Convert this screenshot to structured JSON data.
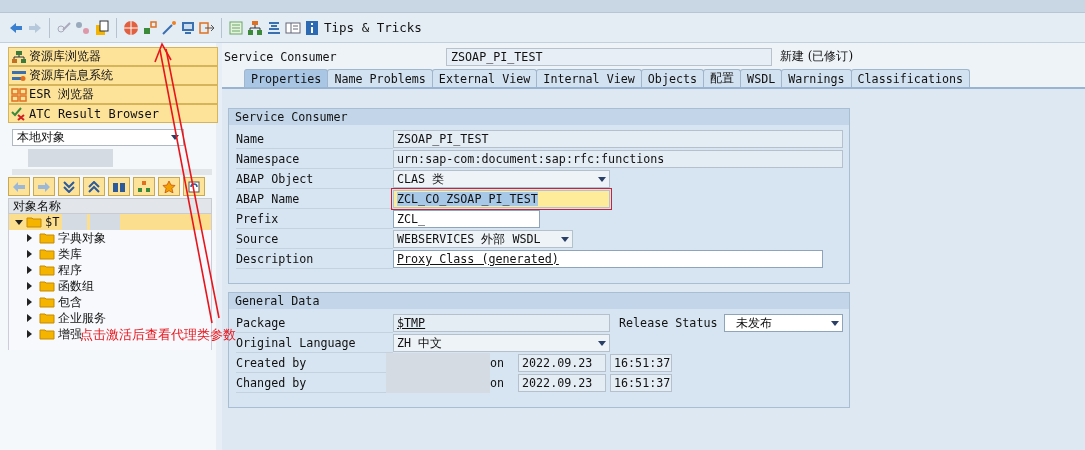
{
  "toolbar": {
    "tips_label": "Tips & Tricks"
  },
  "sidebar": {
    "nav_buttons": [
      {
        "label": "资源库浏览器"
      },
      {
        "label": "资源库信息系统"
      },
      {
        "label": "ESR 浏览器"
      },
      {
        "label": "ATC Result Browser"
      }
    ],
    "object_dropdown": {
      "value": "本地对象"
    },
    "tree_header": "对象名称",
    "tree": [
      {
        "label": "$T",
        "expanded": true,
        "selected": true,
        "children": [
          {
            "label": "字典对象",
            "expanded": false,
            "selected": false
          },
          {
            "label": "类库",
            "expanded": false,
            "selected": false
          },
          {
            "label": "程序",
            "expanded": false,
            "selected": false
          },
          {
            "label": "函数组",
            "expanded": false,
            "selected": false
          },
          {
            "label": "包含",
            "expanded": false,
            "selected": false
          },
          {
            "label": "企业服务",
            "expanded": false,
            "selected": false
          },
          {
            "label": "增强",
            "expanded": false,
            "selected": false
          }
        ]
      }
    ]
  },
  "header": {
    "label": "Service Consumer",
    "value": "ZSOAP_PI_TEST",
    "status": "新建 (已修订)"
  },
  "tabs": [
    {
      "label": "Properties",
      "selected": true
    },
    {
      "label": "Name Problems",
      "selected": false
    },
    {
      "label": "External View",
      "selected": false
    },
    {
      "label": "Internal View",
      "selected": false
    },
    {
      "label": "Objects",
      "selected": false
    },
    {
      "label": "配置",
      "selected": false
    },
    {
      "label": "WSDL",
      "selected": false
    },
    {
      "label": "Warnings",
      "selected": false
    },
    {
      "label": "Classifications",
      "selected": false
    }
  ],
  "service_consumer": {
    "title": "Service Consumer",
    "rows": [
      {
        "label": "Name",
        "value": "ZSOAP_PI_TEST",
        "kind": "display",
        "focused": false
      },
      {
        "label": "Namespace",
        "value": "urn:sap-com:document:sap:rfc:functions",
        "kind": "display",
        "focused": false
      },
      {
        "label": "ABAP Object",
        "value": "CLAS 类",
        "kind": "dropdown",
        "focused": false
      },
      {
        "label": "ABAP Name",
        "value": "ZCL_CO_ZSOAP_PI_TEST",
        "kind": "display",
        "focused": true
      },
      {
        "label": "Prefix",
        "value": "ZCL_",
        "kind": "input",
        "focused": false
      },
      {
        "label": "Source",
        "value": "WEBSERVICES 外部 WSDL",
        "kind": "dropdown",
        "focused": false
      },
      {
        "label": "Description",
        "value": "Proxy Class (generated)",
        "kind": "input",
        "focused": false
      }
    ]
  },
  "general_data": {
    "title": "General Data",
    "package": {
      "label": "Package",
      "value": "$TMP"
    },
    "release_status": {
      "label": "Release Status",
      "value": "未发布"
    },
    "original_language": {
      "label": "Original Language",
      "value": "ZH 中文"
    },
    "audit_rows": [
      {
        "label": "Created by",
        "on": "on",
        "date": "2022.09.23",
        "time": "16:51:37"
      },
      {
        "label": "Changed by",
        "on": "on",
        "date": "2022.09.23",
        "time": "16:51:37"
      }
    ]
  },
  "annotation": {
    "text": "点击激活后查看代理类参数"
  }
}
